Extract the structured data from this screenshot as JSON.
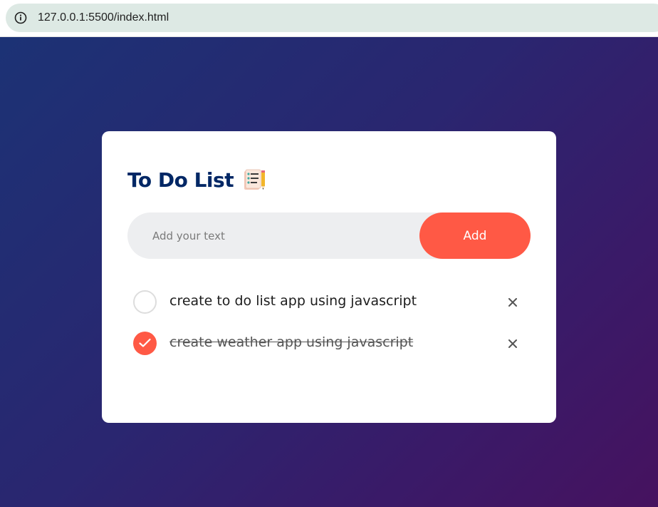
{
  "browser": {
    "url": "127.0.0.1:5500/index.html",
    "info_icon": "info-icon"
  },
  "app": {
    "title": "To Do List",
    "title_icon": "notepad-pencil-icon",
    "input": {
      "placeholder": "Add your text",
      "value": ""
    },
    "add_label": "Add",
    "tasks": [
      {
        "text": "create to do list app using javascript",
        "done": false
      },
      {
        "text": "create weather app using javascript",
        "done": true
      }
    ]
  },
  "colors": {
    "accent": "#ff5945",
    "title": "#002765",
    "input_bg": "#edeef0",
    "gradient_start": "#1c3275",
    "gradient_end": "#46125f"
  }
}
